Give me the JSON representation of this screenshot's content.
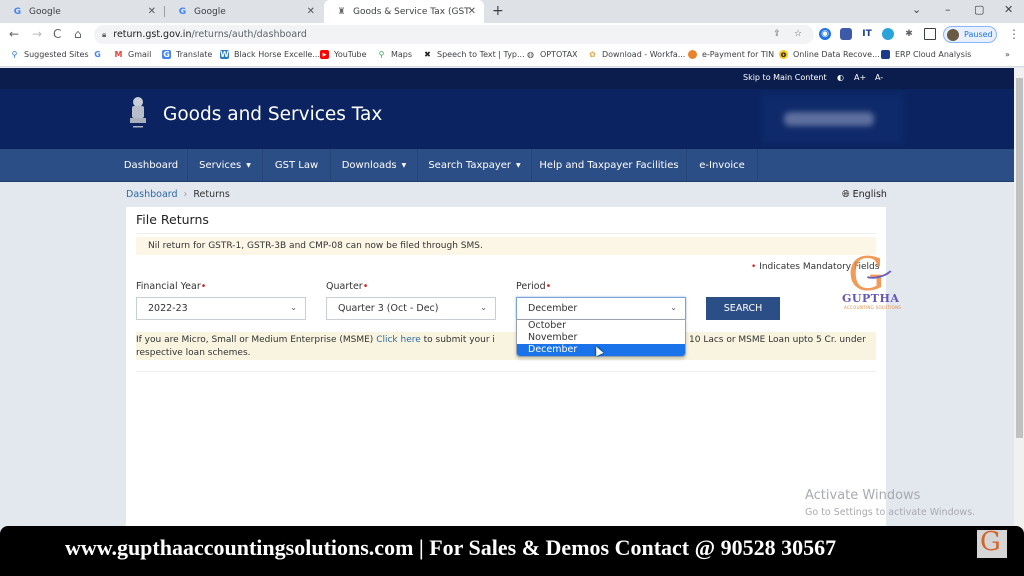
{
  "browser": {
    "tabs": [
      {
        "title": "Google",
        "favicon": "google-g"
      },
      {
        "title": "Google",
        "favicon": "google-g"
      },
      {
        "title": "Goods & Service Tax (GST) | User",
        "favicon": "india-emblem",
        "active": true
      }
    ],
    "new_tab": "+",
    "window_controls": {
      "collapse": "⌄",
      "minimize": "–",
      "maximize": "▢",
      "close": "✕"
    },
    "nav": {
      "back": "←",
      "forward": "→",
      "reload": "C",
      "home": "⌂"
    },
    "url_host": "return.gst.gov.in",
    "url_path": "/returns/auth/dashboard",
    "profile_label": "Paused",
    "bookmarks": [
      {
        "label": "Suggested Sites",
        "icon": "search-icon"
      },
      {
        "label": "",
        "icon": "google-icon"
      },
      {
        "label": "Gmail",
        "icon": "gmail-icon"
      },
      {
        "label": "Translate",
        "icon": "translate-icon"
      },
      {
        "label": "Black Horse Excelle...",
        "icon": "word-icon"
      },
      {
        "label": "YouTube",
        "icon": "youtube-icon"
      },
      {
        "label": "Maps",
        "icon": "maps-icon"
      },
      {
        "label": "Speech to Text | Typ...",
        "icon": "speech-icon"
      },
      {
        "label": "OPTOTAX",
        "icon": "globe-icon"
      },
      {
        "label": "Download - Workfa...",
        "icon": "download-icon"
      },
      {
        "label": "e-Payment for TIN",
        "icon": "payment-icon"
      },
      {
        "label": "Online Data Recove...",
        "icon": "recovery-icon"
      },
      {
        "label": "ERP Cloud Analysis",
        "icon": "erp-icon"
      }
    ],
    "bookmarks_overflow": "»"
  },
  "site": {
    "accessibility": {
      "skip": "Skip to Main Content",
      "contrast": "◐",
      "increase": "A+",
      "decrease": "A-"
    },
    "title": "Goods and Services Tax",
    "nav": [
      {
        "label": "Dashboard",
        "dropdown": false
      },
      {
        "label": "Services",
        "dropdown": true
      },
      {
        "label": "GST Law",
        "dropdown": false
      },
      {
        "label": "Downloads",
        "dropdown": true
      },
      {
        "label": "Search Taxpayer",
        "dropdown": true
      },
      {
        "label": "Help and Taxpayer Facilities",
        "dropdown": false
      },
      {
        "label": "e-Invoice",
        "dropdown": false
      }
    ],
    "caret": "▼",
    "breadcrumb": [
      {
        "label": "Dashboard",
        "link": true
      },
      {
        "label": "Returns",
        "link": false
      }
    ],
    "breadcrumb_sep": "›",
    "language": "English"
  },
  "form": {
    "title": "File Returns",
    "sms_notice": "Nil return for GSTR-1, GSTR-3B and CMP-08 can now be filed through SMS.",
    "mandatory_note": "Indicates Mandatory Fields",
    "required_mark": "•",
    "fields": [
      {
        "label": "Financial Year",
        "value": "2022-23"
      },
      {
        "label": "Quarter",
        "value": "Quarter 3 (Oct - Dec)"
      },
      {
        "label": "Period",
        "value": "December"
      }
    ],
    "period_options": [
      {
        "label": "October",
        "selected": false
      },
      {
        "label": "November",
        "selected": false
      },
      {
        "label": "December",
        "selected": true
      }
    ],
    "search_label": "SEARCH",
    "msme_notice": {
      "before": "If you are Micro, Small or Medium Enterprise (MSME) ",
      "link": "Click here",
      "after_visible": " to submit your i",
      "tail": "10 Lacs or MSME Loan upto 5 Cr. under",
      "line2": "respective loan schemes."
    }
  },
  "watermark": {
    "name": "GUPTHA",
    "subtitle": "ACCOUNTING SOLUTIONS",
    "letter": "G"
  },
  "os_overlay": {
    "line1": "Activate Windows",
    "line2": "Go to Settings to activate Windows."
  },
  "banner": {
    "text": "www.gupthaaccountingsolutions.com | For Sales & Demos Contact @ 90528 30567",
    "logo_letter": "G"
  },
  "colors": {
    "header": "#0b2461",
    "nav": "#2c4e86",
    "link": "#2d6aa6",
    "required": "#e02020",
    "select_highlight": "#1a73e8"
  }
}
